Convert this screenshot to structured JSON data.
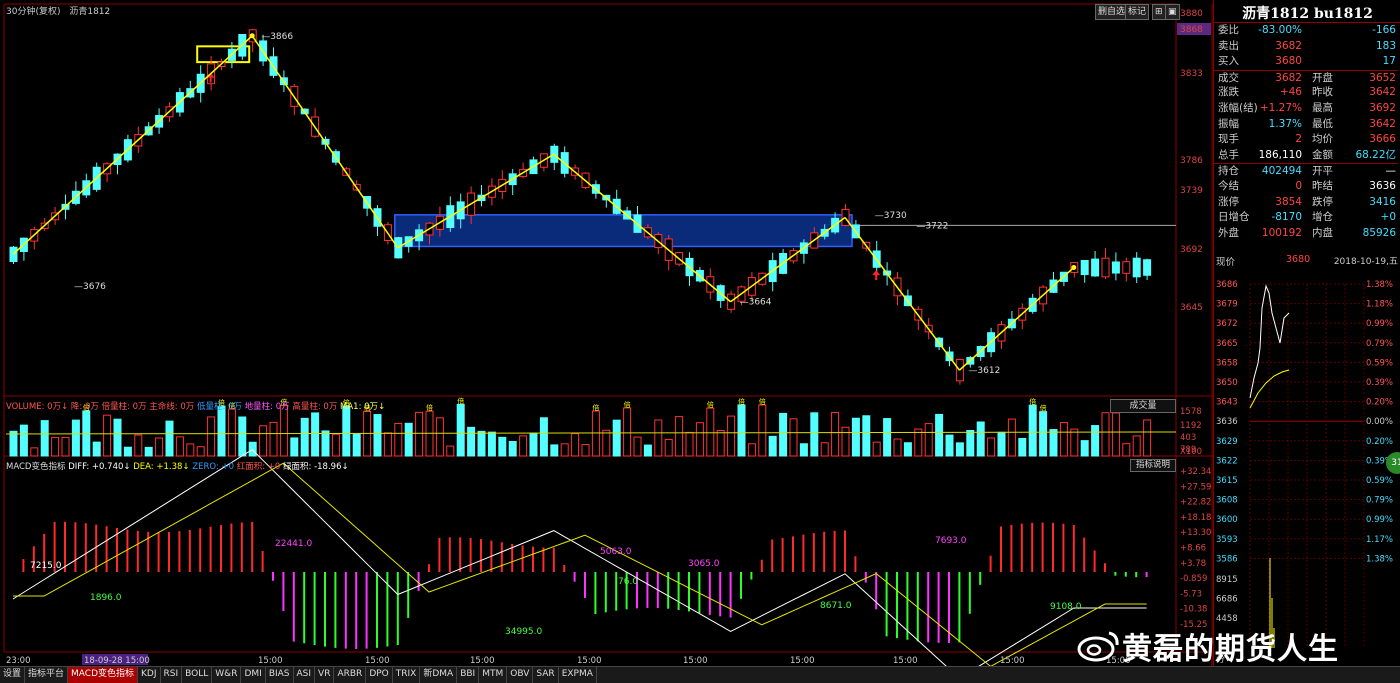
{
  "header": {
    "period": "30分钟(复权)",
    "symbol": "沥青1812",
    "buttons": [
      "删自选",
      "标记",
      "⊞",
      "▣"
    ]
  },
  "colors": {
    "up": "#ff3232",
    "down": "#54ffff",
    "zone": "#0a2a7a",
    "trend": "#ffff00",
    "macd_pos": "#ff2a2a",
    "macd_neg_green": "#2aff2a",
    "macd_neg_magenta": "#ff33ff",
    "diff": "#ffffff",
    "dea": "#e6e600"
  },
  "price_axis": [
    "3880",
    "3868",
    "3833",
    "3786",
    "3739",
    "3692",
    "3645"
  ],
  "price_annotations": [
    "3866",
    "3676",
    "3664",
    "3612",
    "3730",
    "3722"
  ],
  "volume_bar": {
    "labels": [
      "VOLUME: 0万",
      "↓",
      "降: 0万",
      "倍量柱: 0万",
      "主命线: 0万",
      "低量柱: 0万",
      "地量柱: 0万",
      "高量柱: 0万",
      "MA1: 0万",
      "↓"
    ],
    "button": "成交量",
    "axis": [
      "1578",
      "1192",
      "789",
      "403",
      "X100"
    ],
    "marker": "倍"
  },
  "macd_bar": {
    "labels": [
      "MACD变色指标",
      "DIFF: +0.740",
      "↓",
      "DEA: +1.38",
      "↓",
      "ZERO: +0",
      "红面积: +0",
      "绿面积: -18.96",
      "↓"
    ],
    "button": "指标说明",
    "axis": [
      "+32.34",
      "+27.59",
      "+22.82",
      "+18.18",
      "+13.30",
      "+8.66",
      "+3.78",
      "-0.859",
      "-5.73",
      "-10.38",
      "-15.25"
    ],
    "area_labels": [
      "1896.0",
      "22441.0",
      "34995.0",
      "76.0",
      "5063.0",
      "3065.0",
      "8671.0",
      "7693.0",
      "9108.0",
      "7215.0"
    ]
  },
  "time_axis": [
    "23:00",
    "18-09-28 15:00",
    "15:00",
    "15:00",
    "15:00",
    "15:00",
    "15:00",
    "15:00",
    "15:00",
    "15:00",
    "15:00"
  ],
  "quote": {
    "title": "沥青1812 bu1812",
    "rows": [
      {
        "l1": "委比",
        "v1": "-83.00%",
        "c1": "down",
        "l2": "",
        "v2": "-166",
        "c2": "down"
      },
      {
        "l1": "卖出",
        "v1": "3682",
        "c1": "up",
        "l2": "",
        "v2": "183",
        "c2": "down"
      },
      {
        "l1": "买入",
        "v1": "3680",
        "c1": "up",
        "l2": "",
        "v2": "17",
        "c2": "down"
      },
      {
        "l1": "成交",
        "v1": "3682",
        "c1": "up",
        "l2": "开盘",
        "v2": "3652",
        "c2": "up"
      },
      {
        "l1": "涨跌",
        "v1": "+46",
        "c1": "up",
        "l2": "昨收",
        "v2": "3642",
        "c2": "up"
      },
      {
        "l1": "涨幅(结)",
        "v1": "+1.27%",
        "c1": "up",
        "l2": "最高",
        "v2": "3692",
        "c2": "up"
      },
      {
        "l1": "振幅",
        "v1": "1.37%",
        "c1": "down",
        "l2": "最低",
        "v2": "3642",
        "c2": "up"
      },
      {
        "l1": "现手",
        "v1": "2",
        "c1": "up",
        "l2": "均价",
        "v2": "3666",
        "c2": "up"
      },
      {
        "l1": "总手",
        "v1": "186,110",
        "c1": "white",
        "l2": "金额",
        "v2": "68.22亿",
        "c2": "down"
      },
      {
        "l1": "持仓",
        "v1": "402494",
        "c1": "down",
        "l2": "开平",
        "v2": "—",
        "c2": "white"
      },
      {
        "l1": "今结",
        "v1": "0",
        "c1": "up",
        "l2": "昨结",
        "v2": "3636",
        "c2": "white"
      },
      {
        "l1": "涨停",
        "v1": "3854",
        "c1": "up",
        "l2": "跌停",
        "v2": "3416",
        "c2": "down"
      },
      {
        "l1": "日增仓",
        "v1": "-8170",
        "c1": "down",
        "l2": "增仓",
        "v2": "+0",
        "c2": "down"
      },
      {
        "l1": "外盘",
        "v1": "100192",
        "c1": "up",
        "l2": "内盘",
        "v2": "85926",
        "c2": "down"
      }
    ]
  },
  "mini_chart": {
    "label_price": "现价",
    "price": "3680",
    "date": "2018-10-19,五",
    "left_axis": [
      "3686",
      "3679",
      "3672",
      "3665",
      "3658",
      "3650",
      "3643",
      "3636",
      "3629",
      "3622",
      "3615",
      "3608",
      "3600",
      "3593",
      "3586"
    ],
    "right_axis": [
      "1.38%",
      "1.18%",
      "0.99%",
      "0.79%",
      "0.59%",
      "0.39%",
      "0.20%",
      "0.00%",
      "0.20%",
      "0.39%",
      "0.59%",
      "0.79%",
      "0.99%",
      "1.17%",
      "1.38%"
    ],
    "vol_axis": [
      "8915",
      "6686",
      "4458"
    ],
    "bottom_label": "分",
    "circle": "31"
  },
  "watermark": "黄磊的期货人生",
  "tabs": [
    "设置",
    "指标平台",
    "MACD变色指标",
    "KDJ",
    "RSI",
    "BOLL",
    "W&R",
    "DMI",
    "BIAS",
    "ASI",
    "VR",
    "ARBR",
    "DPO",
    "TRIX",
    "新DMA",
    "BBI",
    "MTM",
    "OBV",
    "SAR",
    "EXPMA"
  ],
  "active_tab": "MACD变色指标",
  "chart_data": {
    "type": "candlestick",
    "price_range": [
      3600,
      3880
    ],
    "trend_points": [
      {
        "bar": 0,
        "price": 3700
      },
      {
        "bar": 23,
        "price": 3866
      },
      {
        "bar": 37,
        "price": 3705
      },
      {
        "bar": 52,
        "price": 3776
      },
      {
        "bar": 69,
        "price": 3664
      },
      {
        "bar": 80,
        "price": 3728
      },
      {
        "bar": 91,
        "price": 3612
      },
      {
        "bar": 102,
        "price": 3690
      }
    ],
    "zone": {
      "from_bar": 37,
      "to_bar": 80,
      "low": 3706,
      "high": 3730
    },
    "resistance": 3722
  }
}
